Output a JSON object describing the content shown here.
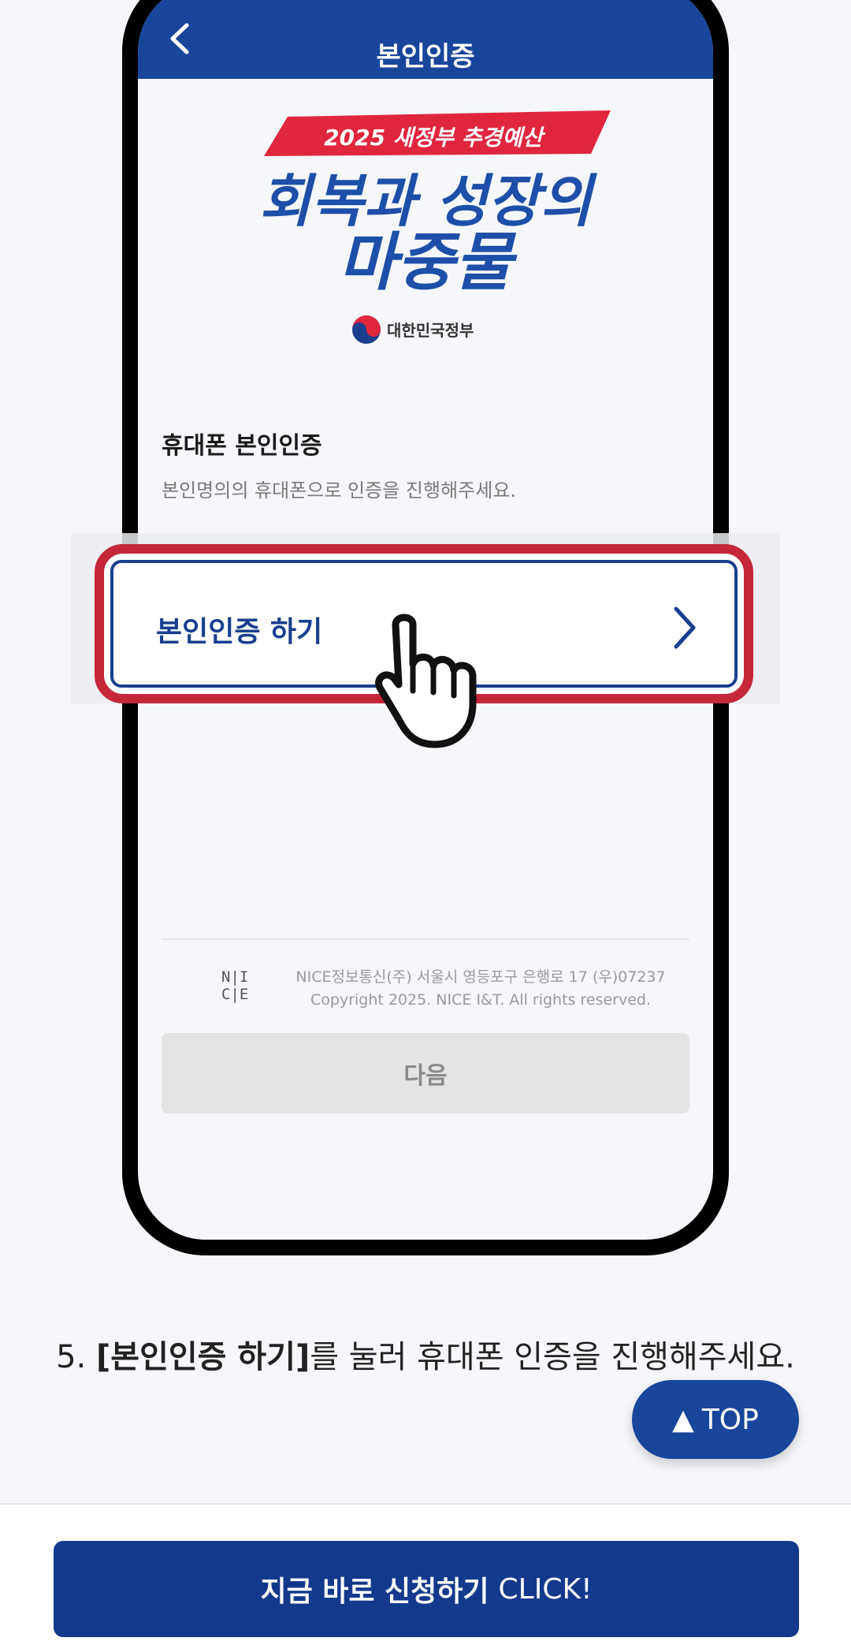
{
  "app_bar": {
    "title": "본인인증"
  },
  "banner": {
    "ribbon": "2025 새정부 추경예산",
    "title_line1": "회복과 성장의",
    "title_line2": "마중물",
    "gov_label": "대한민국정부"
  },
  "section": {
    "title": "휴대폰 본인인증",
    "description": "본인명의의 휴대폰으로 인증을 진행해주세요."
  },
  "verify_button": {
    "label": "본인인증 하기"
  },
  "footer": {
    "nice_logo": [
      "N",
      "I",
      "C",
      "E"
    ],
    "address": "NICE정보통신(주) 서울시 영등포구 은행로 17 (우)07237",
    "copyright": "Copyright 2025. NICE I&T. All rights reserved."
  },
  "next_button": {
    "label": "다음"
  },
  "instruction": {
    "number": "5.",
    "bold": "[본인인증 하기]",
    "rest": "를 눌러 휴대폰 인증을 진행해주세요."
  },
  "top_button": {
    "label": "TOP"
  },
  "cta": {
    "bold": "지금 바로 신청하기",
    "light": "CLICK!"
  },
  "colors": {
    "primary": "#17469b",
    "highlight": "#c5263a",
    "ribbon": "#e0263e"
  }
}
